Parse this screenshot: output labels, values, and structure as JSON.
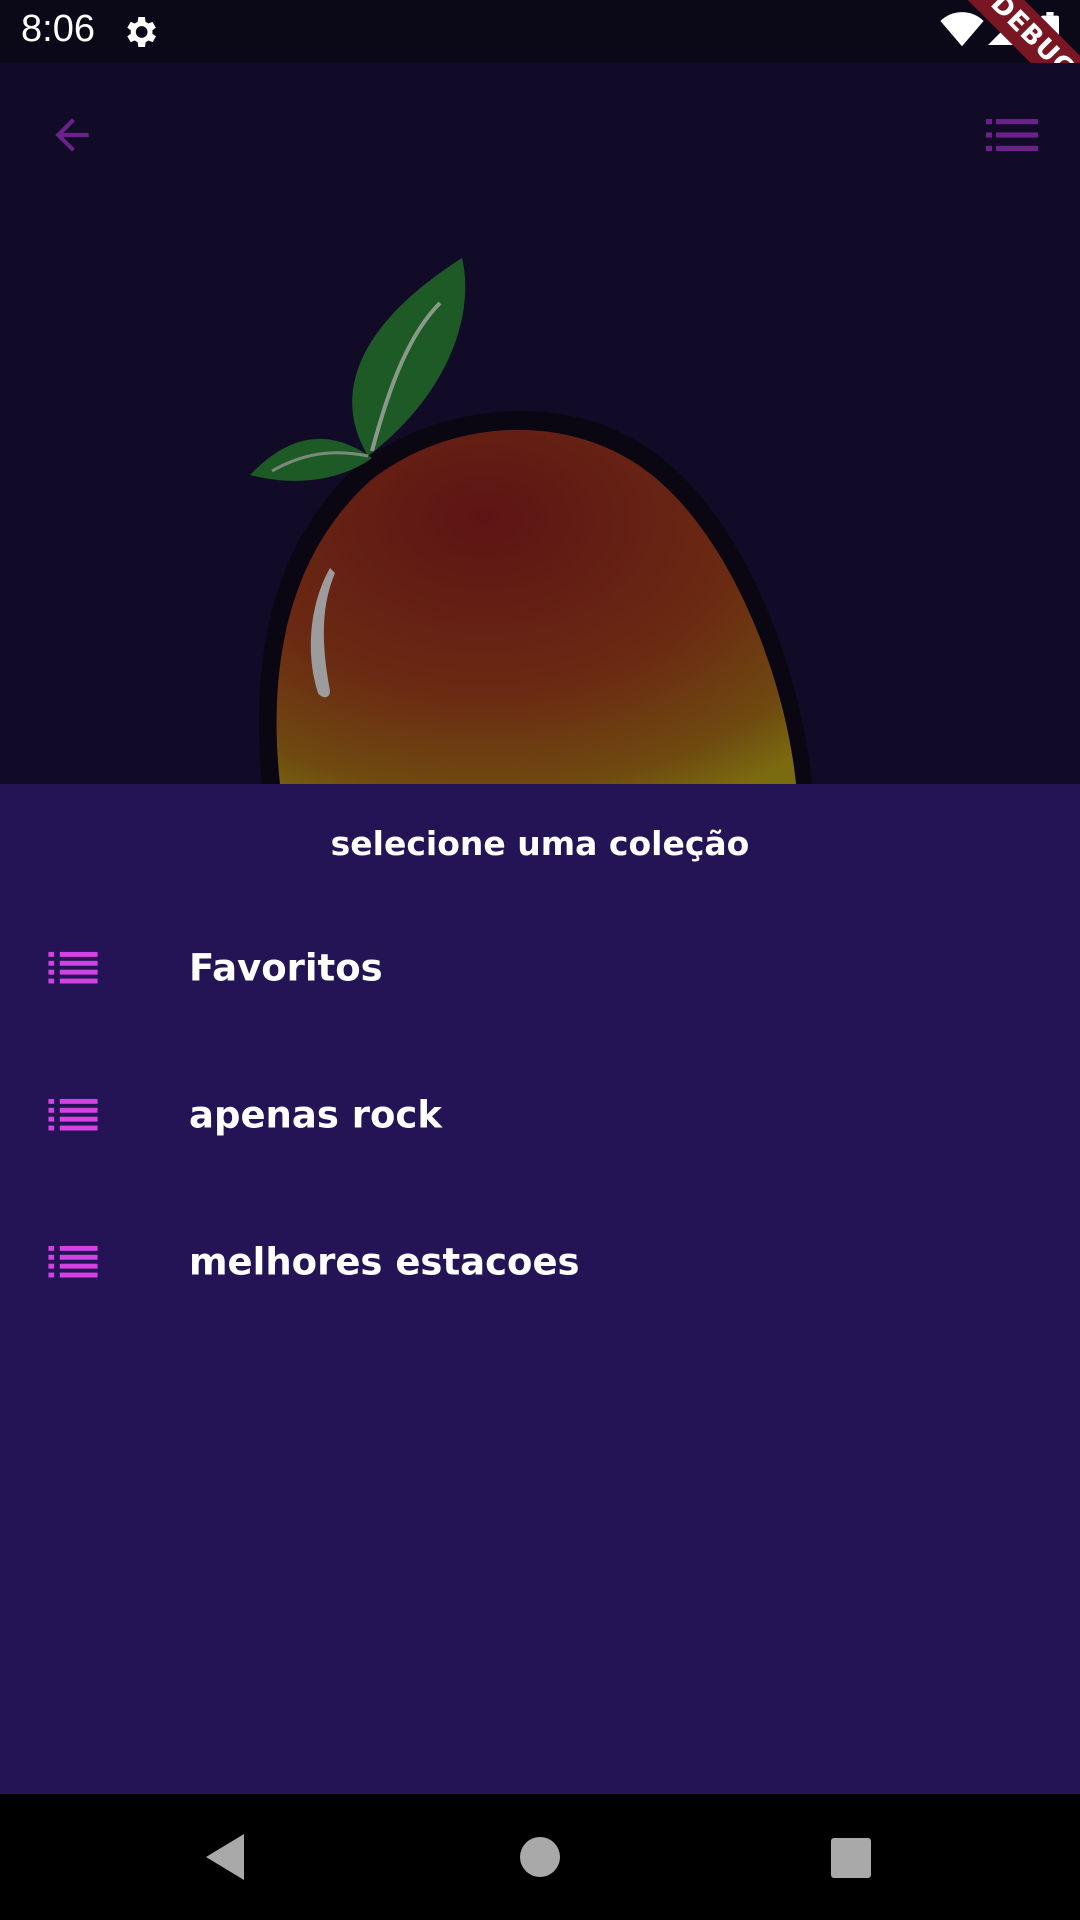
{
  "status_bar": {
    "time": "8:06",
    "icons": [
      "gear-icon",
      "wifi-icon",
      "signal-icon",
      "battery-icon"
    ]
  },
  "debug_banner": {
    "label": "DEBUG"
  },
  "header": {
    "back_icon": "arrow-back-icon",
    "playlist_icon": "playlist-icon"
  },
  "sheet": {
    "title": "selecione uma coleção",
    "items": [
      {
        "icon": "list-icon",
        "label": "Favoritos"
      },
      {
        "icon": "list-icon",
        "label": "apenas rock"
      },
      {
        "icon": "list-icon",
        "label": "melhores estacoes"
      }
    ]
  },
  "nav_bar": {
    "icons": [
      "nav-back-icon",
      "nav-home-icon",
      "nav-recents-icon"
    ]
  },
  "colors": {
    "background": "#120b27",
    "sheet": "#241455",
    "accent": "#d442e6",
    "header_icon": "#6a2189",
    "debug": "#7a1622"
  }
}
